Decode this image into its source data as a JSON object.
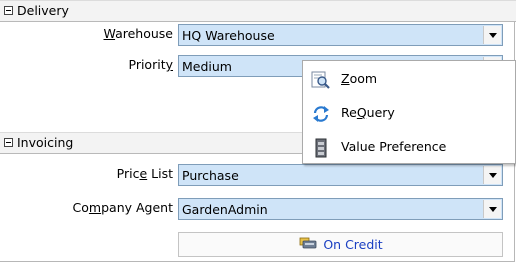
{
  "delivery": {
    "title": "Delivery",
    "warehouse_label_pre": "",
    "warehouse_label_ul": "W",
    "warehouse_label_post": "arehouse",
    "warehouse_value": "HQ Warehouse",
    "priority_label_pre": "Priorit",
    "priority_label_ul": "y",
    "priority_label_post": "",
    "priority_value": "Medium"
  },
  "invoicing": {
    "title": "Invoicing",
    "price_list_label_pre": "Pric",
    "price_list_label_ul": "e",
    "price_list_label_post": " List",
    "price_list_value": "Purchase",
    "company_agent_label_pre": "Co",
    "company_agent_label_ul": "m",
    "company_agent_label_post": "pany Agent",
    "company_agent_value": "GardenAdmin",
    "credit_button_label": "On Credit"
  },
  "context_menu": {
    "zoom_ul": "Z",
    "zoom_rest": "oom",
    "requery_pre": "Re",
    "requery_ul": "Q",
    "requery_post": "uery",
    "value_preference": "Value Preference"
  },
  "colors": {
    "field_background": "#cfe4f8",
    "button_text": "#1a3fc2"
  }
}
